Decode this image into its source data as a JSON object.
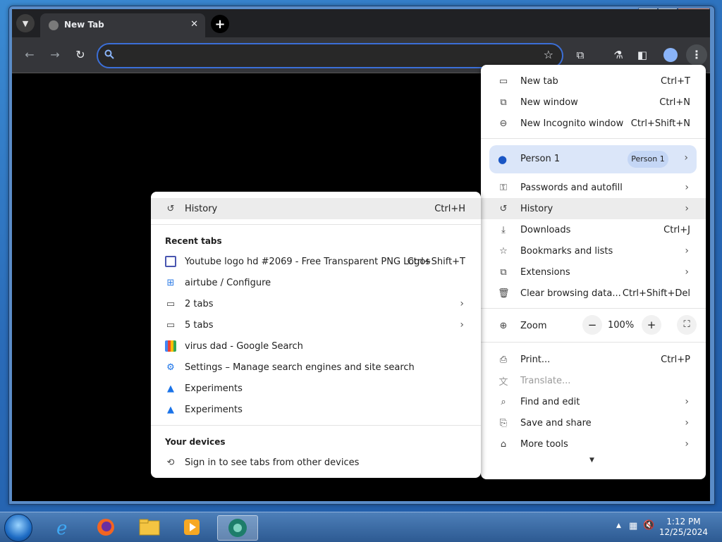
{
  "browser": {
    "tab": {
      "title": "New Tab",
      "close": "✕"
    },
    "tab_search_icon": "chevron-down-icon",
    "new_tab_symbol": "+",
    "omnibox": {
      "value": "",
      "placeholder": ""
    }
  },
  "window_controls": {
    "minimize": "▁",
    "maximize": "▢",
    "close": "✕"
  },
  "main_menu": {
    "items_top": [
      {
        "label": "New tab",
        "shortcut": "Ctrl+T",
        "icon": "new-tab-icon"
      },
      {
        "label": "New window",
        "shortcut": "Ctrl+N",
        "icon": "new-window-icon"
      },
      {
        "label": "New Incognito window",
        "shortcut": "Ctrl+Shift+N",
        "icon": "incognito-icon"
      }
    ],
    "person": {
      "label": "Person 1",
      "chip": "Person 1"
    },
    "items_mid": [
      {
        "label": "Passwords and autofill",
        "icon": "key-icon"
      },
      {
        "label": "History",
        "icon": "history-icon"
      },
      {
        "label": "Downloads",
        "shortcut": "Ctrl+J",
        "icon": "download-icon"
      },
      {
        "label": "Bookmarks and lists",
        "icon": "star-icon"
      },
      {
        "label": "Extensions",
        "icon": "puzzle-icon"
      },
      {
        "label": "Clear browsing data...",
        "shortcut": "Ctrl+Shift+Del",
        "icon": "trash-icon"
      }
    ],
    "zoom": {
      "label": "Zoom",
      "value": "100%",
      "minus": "−",
      "plus": "+"
    },
    "items_bottom": [
      {
        "label": "Print...",
        "shortcut": "Ctrl+P",
        "icon": "print-icon"
      },
      {
        "label": "Translate...",
        "icon": "translate-icon"
      },
      {
        "label": "Find and edit",
        "icon": "find-icon"
      },
      {
        "label": "Save and share",
        "icon": "save-share-icon"
      },
      {
        "label": "More tools",
        "icon": "toolbox-icon"
      }
    ]
  },
  "history_menu": {
    "history": {
      "label": "History",
      "shortcut": "Ctrl+H"
    },
    "recent_heading": "Recent tabs",
    "recent": [
      {
        "label": "Youtube logo hd #2069 - Free Transparent PNG Logos",
        "shortcut": "Ctrl+Shift+T",
        "icon": "site-favicon"
      },
      {
        "label": "airtube / Configure",
        "icon": "airtube-favicon"
      },
      {
        "label": "2 tabs",
        "icon": "window-icon"
      },
      {
        "label": "5 tabs",
        "icon": "window-icon"
      },
      {
        "label": "virus dad - Google Search",
        "icon": "google-favicon"
      },
      {
        "label": "Settings – Manage search engines and site search",
        "icon": "settings-icon"
      },
      {
        "label": "Experiments",
        "icon": "flask-icon"
      },
      {
        "label": "Experiments",
        "icon": "flask-icon"
      }
    ],
    "devices_heading": "Your devices",
    "devices_item": "Sign in to see tabs from other devices"
  },
  "taskbar": {
    "clock_time": "1:12 PM",
    "clock_date": "12/25/2024"
  }
}
